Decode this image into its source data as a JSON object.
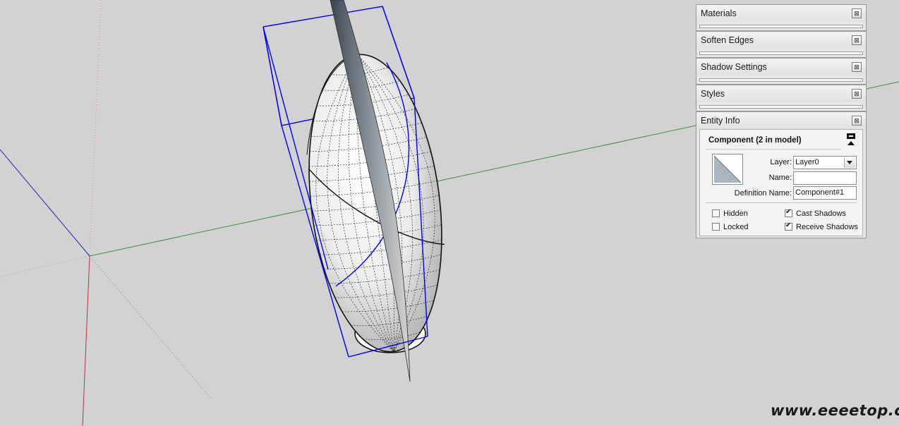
{
  "trays": [
    {
      "title": "Materials"
    },
    {
      "title": "Soften Edges"
    },
    {
      "title": "Shadow Settings"
    },
    {
      "title": "Styles"
    }
  ],
  "entity_info": {
    "title": "Entity Info",
    "heading": "Component (2 in model)",
    "layer_label": "Layer:",
    "layer_value": "Layer0",
    "name_label": "Name:",
    "name_value": "",
    "definition_label": "Definition Name:",
    "definition_value": "Component#1",
    "hidden_label": "Hidden",
    "hidden_checked": false,
    "locked_label": "Locked",
    "locked_checked": false,
    "cast_label": "Cast Shadows",
    "cast_checked": true,
    "receive_label": "Receive Shadows",
    "receive_checked": true
  },
  "close_glyph": "⊠",
  "watermark": "www.eeeetop.com",
  "colors": {
    "background": "#d2d2d2",
    "axis_red": "#d02020",
    "axis_green": "#2f9a2f",
    "axis_blue": "#2020c8",
    "selection": "#0000ff"
  }
}
